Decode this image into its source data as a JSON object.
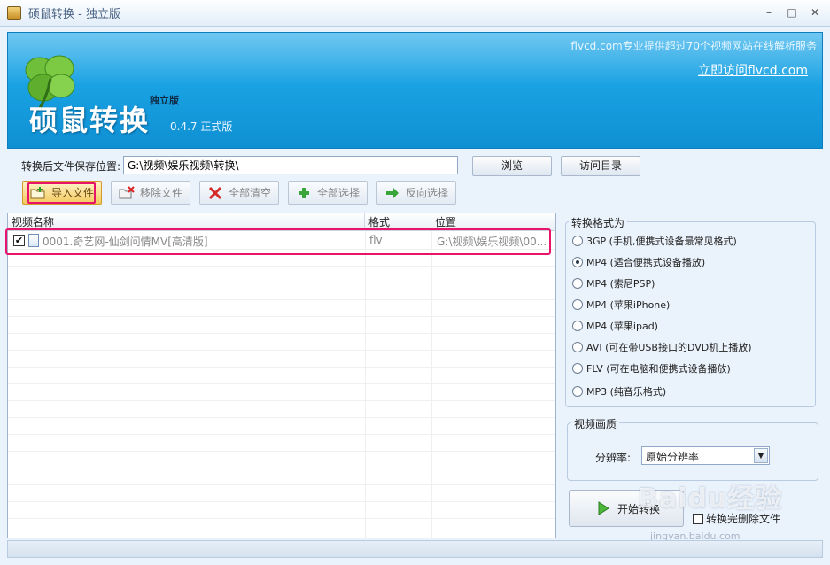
{
  "window": {
    "title": "硕鼠转换 - 独立版",
    "controls": {
      "minimize": "–",
      "maximize": "□",
      "close": "✕"
    }
  },
  "banner": {
    "brand": "硕鼠转换",
    "edition": "独立版",
    "version": "0.4.7 正式版",
    "tagline": "flvcd.com专业提供超过70个视频网站在线解析服务",
    "link": "立即访问flvcd.com"
  },
  "save": {
    "label": "转换后文件保存位置:",
    "path": "G:\\视频\\娱乐视频\\转换\\",
    "browse_button": "浏览",
    "open_dir_button": "访问目录"
  },
  "toolbar": {
    "import": "导入文件",
    "remove": "移除文件",
    "clear_all": "全部清空",
    "select_all": "全部选择",
    "invert_select": "反向选择"
  },
  "file_list": {
    "columns": [
      "视频名称",
      "格式",
      "位置"
    ],
    "rows": [
      {
        "checked": true,
        "name": "0001.奇艺网-仙剑问情MV[高清版]",
        "format": "flv",
        "location": "G:\\视频\\娱乐视频\\00..."
      }
    ]
  },
  "convert_format": {
    "title": "转换格式为",
    "options": [
      {
        "label": "3GP (手机,便携式设备最常见格式)",
        "checked": false
      },
      {
        "label": "MP4 (适合便携式设备播放)",
        "checked": true
      },
      {
        "label": "MP4 (索尼PSP)",
        "checked": false
      },
      {
        "label": "MP4 (苹果iPhone)",
        "checked": false
      },
      {
        "label": "MP4 (苹果ipad)",
        "checked": false
      },
      {
        "label": "AVI (可在带USB接口的DVD机上播放)",
        "checked": false
      },
      {
        "label": "FLV (可在电脑和便携式设备播放)",
        "checked": false
      },
      {
        "label": "MP3 (纯音乐格式)",
        "checked": false
      }
    ]
  },
  "quality": {
    "title": "视频画质",
    "resolution_label": "分辨率:",
    "resolution_value": "原始分辨率"
  },
  "actions": {
    "start_button": "开始转换",
    "delete_after_label": "转换完删除文件"
  },
  "watermark": {
    "main": "Baidu经验",
    "sub": "jingyan.baidu.com"
  },
  "colors": {
    "banner": "#19a2e3",
    "highlight": "#e8136b",
    "window_bg": "#eaf2fb"
  }
}
